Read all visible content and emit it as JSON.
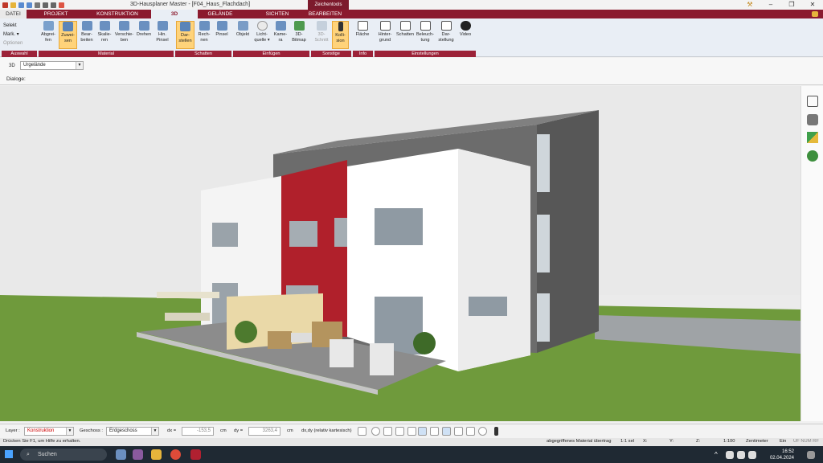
{
  "titlebar": {
    "title": "3D-Hausplaner Master - [F04_Haus_Flachdach]",
    "context_tab": "Zeichentools",
    "win_buttons": [
      "–",
      "❐",
      "✕"
    ]
  },
  "tabs": [
    "DATEI",
    "PROJEKT",
    "KONSTRUKTION",
    "3D",
    "GELÄNDE",
    "SICHTEN",
    "BEARBEITEN"
  ],
  "ribbon": {
    "auswahl": [
      "Selekt",
      "Mark. ▾",
      "Optionen"
    ],
    "buttons": {
      "abgreifen": "Abgrei-fen",
      "zuweisen": "Zuwei-sen",
      "bearbeiten": "Bear-beiten",
      "skalieren": "Skalie-ren",
      "verschieben": "Verschie-ben",
      "drehen": "Drehen",
      "hinpinsel": "Hin. Pinsel",
      "darstellen": "Dar-stellen",
      "rechnen": "Rech-nen",
      "pinsel": "Pinsel",
      "objekt": "Objekt",
      "lichtquelle": "Licht-quelle ▾",
      "kamera": "Kame-ra",
      "bitmap": "3D-Bitmap",
      "schnitt": "3D-Schnitt",
      "kollision": "Kolli-sion",
      "flaeche": "Fläche",
      "hintergrund": "Hinter-grund",
      "schatten": "Schatten",
      "beleuchtung": "Beleuch-tung",
      "darstellung": "Dar-stellung",
      "video": "Video"
    },
    "groups": [
      "Auswahl",
      "Material",
      "Schatten",
      "Einfügen",
      "Sonstige",
      "Info",
      "Einstellungen"
    ]
  },
  "bar3d": {
    "label": "3D",
    "combo": "Urgelände"
  },
  "dialog_label": "Dialoge:",
  "bottombar": {
    "layer_label": "Layer :",
    "layer_value": "Konstruktion",
    "geschoss_label": "Geschoss :",
    "geschoss_value": "Erdgeschoss",
    "dx_label": "dx =",
    "dx_value": "-153,5",
    "cm1": "cm",
    "dy_label": "dy =",
    "dy_value": "3263,4",
    "cm2": "cm",
    "coord_mode": "dx,dy (relativ kartesisch)"
  },
  "status": {
    "hint": "Drücken Sie F1, um Hilfe zu erhalten.",
    "material": "abgegriffenes Material übertrag",
    "scale": "1:1 sel",
    "x": "X:",
    "y": "Y:",
    "z": "Z:",
    "ratio": "1:100",
    "unit": "Zentimeter",
    "ein": "Ein",
    "flags": "UF  NUM  RF"
  },
  "taskbar": {
    "search": "Suchen",
    "time": "16:52",
    "date": "02.04.2024"
  },
  "colors": {
    "accent": "#8b1a2e",
    "selected": "#ffd37a",
    "grass": "#6f9a3c"
  }
}
